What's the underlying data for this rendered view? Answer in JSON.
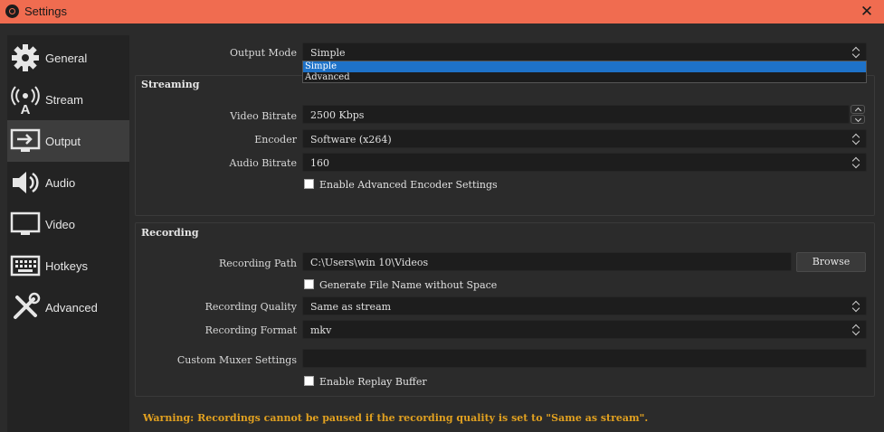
{
  "window": {
    "title": "Settings"
  },
  "sidebar": {
    "items": [
      {
        "label": "General",
        "icon": "gear-icon"
      },
      {
        "label": "Stream",
        "icon": "antenna-icon"
      },
      {
        "label": "Output",
        "icon": "monitor-arrow-icon"
      },
      {
        "label": "Audio",
        "icon": "speaker-icon"
      },
      {
        "label": "Video",
        "icon": "monitor-icon"
      },
      {
        "label": "Hotkeys",
        "icon": "keyboard-icon"
      },
      {
        "label": "Advanced",
        "icon": "tools-icon"
      }
    ],
    "active": "Output"
  },
  "output_mode": {
    "label": "Output Mode",
    "value": "Simple",
    "options": [
      "Simple",
      "Advanced"
    ],
    "selected_option": "Simple"
  },
  "streaming": {
    "title": "Streaming",
    "video_bitrate": {
      "label": "Video Bitrate",
      "value": "2500 Kbps"
    },
    "encoder": {
      "label": "Encoder",
      "value": "Software (x264)"
    },
    "audio_bitrate": {
      "label": "Audio Bitrate",
      "value": "160"
    },
    "advanced_encoder": {
      "label": "Enable Advanced Encoder Settings",
      "checked": false
    }
  },
  "recording": {
    "title": "Recording",
    "path": {
      "label": "Recording Path",
      "value": "C:\\Users\\win 10\\Videos"
    },
    "browse_label": "Browse",
    "no_space": {
      "label": "Generate File Name without Space",
      "checked": false
    },
    "quality": {
      "label": "Recording Quality",
      "value": "Same as stream"
    },
    "format": {
      "label": "Recording Format",
      "value": "mkv"
    },
    "muxer": {
      "label": "Custom Muxer Settings",
      "value": ""
    },
    "replay_buffer": {
      "label": "Enable Replay Buffer",
      "checked": false
    }
  },
  "warning": "Warning: Recordings cannot be paused if the recording quality is set to \"Same as stream\".",
  "colors": {
    "titlebar": "#f06c50",
    "warning": "#e0a020",
    "selection": "#1e72c8"
  }
}
